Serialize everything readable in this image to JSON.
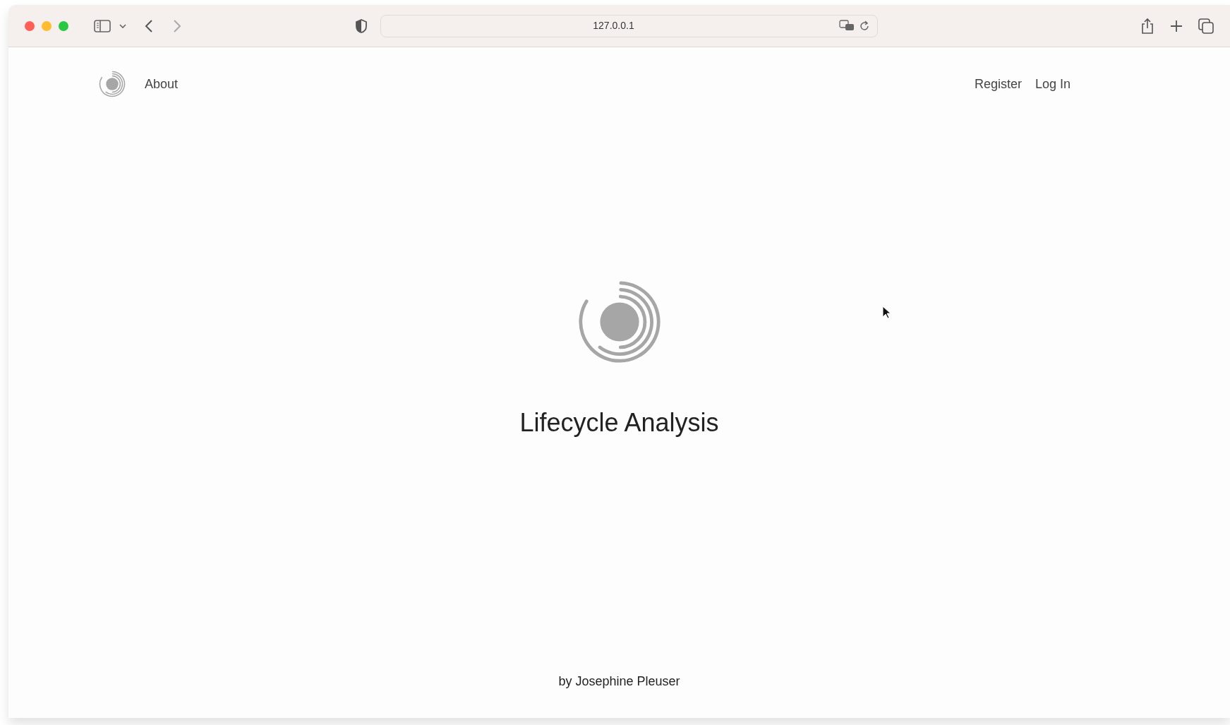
{
  "browser": {
    "address": "127.0.0.1"
  },
  "nav": {
    "left_links": [
      "About"
    ],
    "right_links": [
      "Register",
      "Log In"
    ]
  },
  "hero": {
    "title": "Lifecycle Analysis"
  },
  "footer": {
    "text": "by Josephine Pleuser"
  }
}
